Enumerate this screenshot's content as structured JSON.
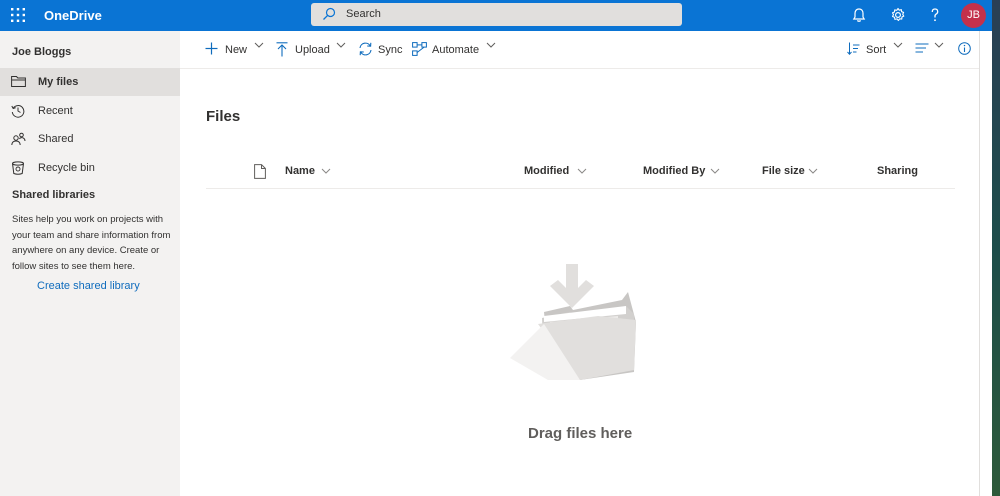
{
  "app": {
    "brand": "OneDrive"
  },
  "topbar": {
    "search_placeholder": "Search",
    "icons": [
      "app-launcher-icon",
      "bell-icon",
      "gear-icon",
      "help-icon"
    ],
    "avatar_initials": "JB",
    "accent_color": "#0a74d4",
    "avatar_color": "#c4314b"
  },
  "sidebar": {
    "user_name": "Joe Bloggs",
    "items": [
      {
        "label": "My files",
        "icon": "folder-icon",
        "active": true
      },
      {
        "label": "Recent",
        "icon": "clock-icon",
        "active": false
      },
      {
        "label": "Shared",
        "icon": "people-icon",
        "active": false
      },
      {
        "label": "Recycle bin",
        "icon": "recycle-bin-icon",
        "active": false
      }
    ],
    "shared_libraries": {
      "title": "Shared libraries",
      "description": "Sites help you work on projects with your team and share information from anywhere on any device. Create or follow sites to see them here.",
      "link": "Create shared library"
    }
  },
  "commandbar": {
    "new": "New",
    "upload": "Upload",
    "sync": "Sync",
    "automate": "Automate",
    "sort": "Sort"
  },
  "main": {
    "title": "Files",
    "columns": [
      "Name",
      "Modified",
      "Modified By",
      "File size",
      "Sharing"
    ],
    "empty_message": "Drag files here"
  }
}
